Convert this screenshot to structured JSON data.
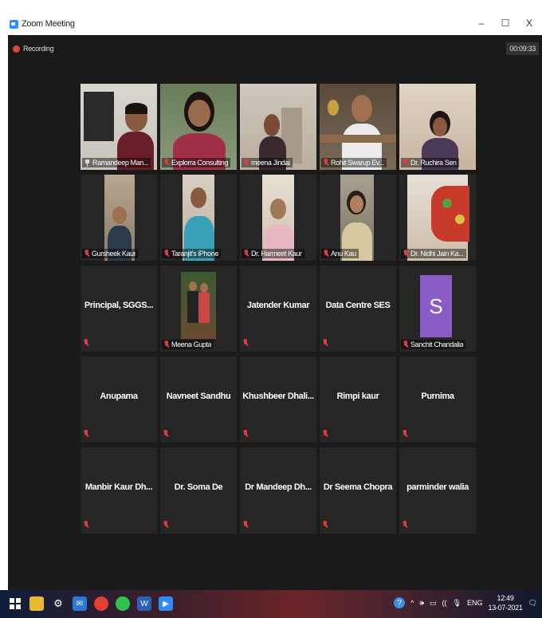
{
  "window": {
    "title": "Zoom Meeting",
    "controls": {
      "minimize": "–",
      "maximize": "☐",
      "close": "X"
    }
  },
  "meeting": {
    "recording_label": "Recording",
    "timer": "00:09:33"
  },
  "participants": [
    {
      "name": "Ramandeep Man...",
      "video": true,
      "active": true,
      "pinned": true
    },
    {
      "name": "Explorra Consulting",
      "video": true
    },
    {
      "name": "meena Jindal",
      "video": true
    },
    {
      "name": "Rohit Swarup Ev...",
      "video": true
    },
    {
      "name": "Dr. Ruchira Sen",
      "video": true
    },
    {
      "name": "Gursheek Kaur",
      "video": true
    },
    {
      "name": "Taranjit's iPhone",
      "video": true
    },
    {
      "name": "Dr. Harmeet Kaur",
      "video": true
    },
    {
      "name": "Anu Kau",
      "video": true
    },
    {
      "name": "Dr. Nidhi Jain Ka...",
      "video": true
    },
    {
      "name": "Principal,  SGGS...",
      "video": false
    },
    {
      "name": "Meena Gupta",
      "video": true
    },
    {
      "name": "Jatender Kumar",
      "video": false
    },
    {
      "name": "Data Centre SES",
      "video": false
    },
    {
      "name": "Sanchit Chandalia",
      "video": false,
      "avatar_letter": "S"
    },
    {
      "name": "Anupama",
      "video": false
    },
    {
      "name": "Navneet Sandhu",
      "video": false
    },
    {
      "name": "Khushbeer  Dhali...",
      "video": false
    },
    {
      "name": "Rimpi kaur",
      "video": false
    },
    {
      "name": "Purnima",
      "video": false
    },
    {
      "name": "Manbir Kaur Dh...",
      "video": false
    },
    {
      "name": "Dr. Soma De",
      "video": false
    },
    {
      "name": "Dr Mandeep  Dh...",
      "video": false
    },
    {
      "name": "Dr Seema Chopra",
      "video": false
    },
    {
      "name": "parminder walia",
      "video": false
    }
  ],
  "taskbar": {
    "tray_language": "ENG",
    "tray_time": "12:49",
    "tray_date": "13-07-2021",
    "tray_help": "?",
    "tray_chevron": "^",
    "tray_volume": "🕪",
    "tray_battery": "▭",
    "tray_network": "((",
    "tray_mic": "🎙",
    "tray_notification": "🗨"
  }
}
